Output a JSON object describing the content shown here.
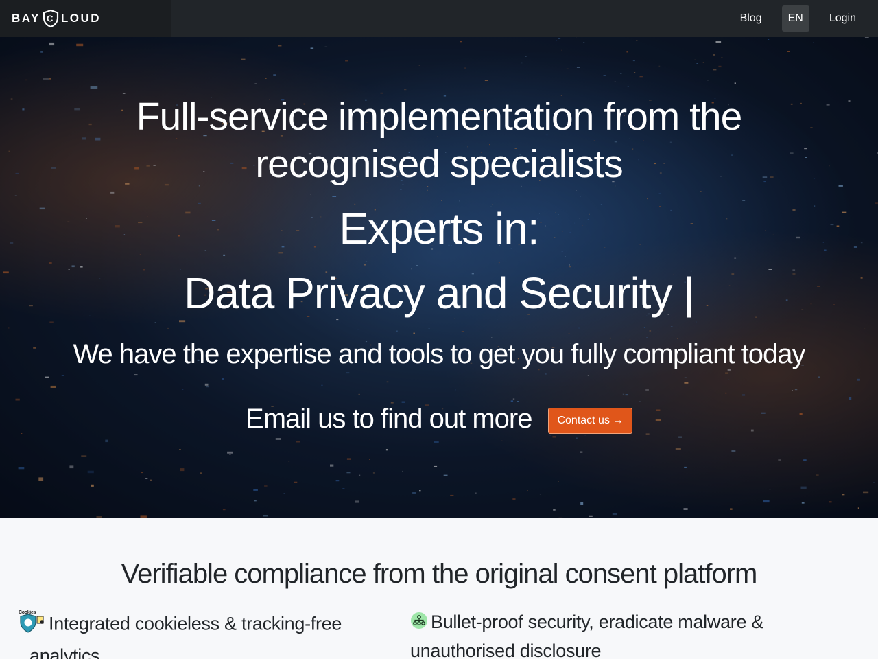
{
  "nav": {
    "brand_left": "BAY",
    "brand_mid": "C",
    "brand_right": "LOUD",
    "links": {
      "blog": "Blog",
      "lang": "EN",
      "login": "Login"
    }
  },
  "hero": {
    "headline_line1": "Full-service implementation from the",
    "headline_line2": "recognised specialists",
    "experts": "Experts in:",
    "rotating": "Data Privacy and Security |",
    "subtitle": "We have the expertise and tools to get you fully compliant today",
    "cta_text": "Email us to find out more",
    "cta_button": "Contact us",
    "cta_arrow": "→"
  },
  "section": {
    "title": "Verifiable compliance from the original consent platform",
    "features": [
      {
        "icon": "cookie-shield-icon",
        "icon_label": "Cookies",
        "line1": "Integrated cookieless & tracking-free",
        "line2": "analytics"
      },
      {
        "icon": "network-icon",
        "line1": "Bullet-proof security, eradicate malware &",
        "line2": "unauthorised disclosure"
      }
    ]
  },
  "colors": {
    "navbar": "#212529",
    "accent": "#e0561a",
    "section_bg": "#f7f8fa"
  }
}
